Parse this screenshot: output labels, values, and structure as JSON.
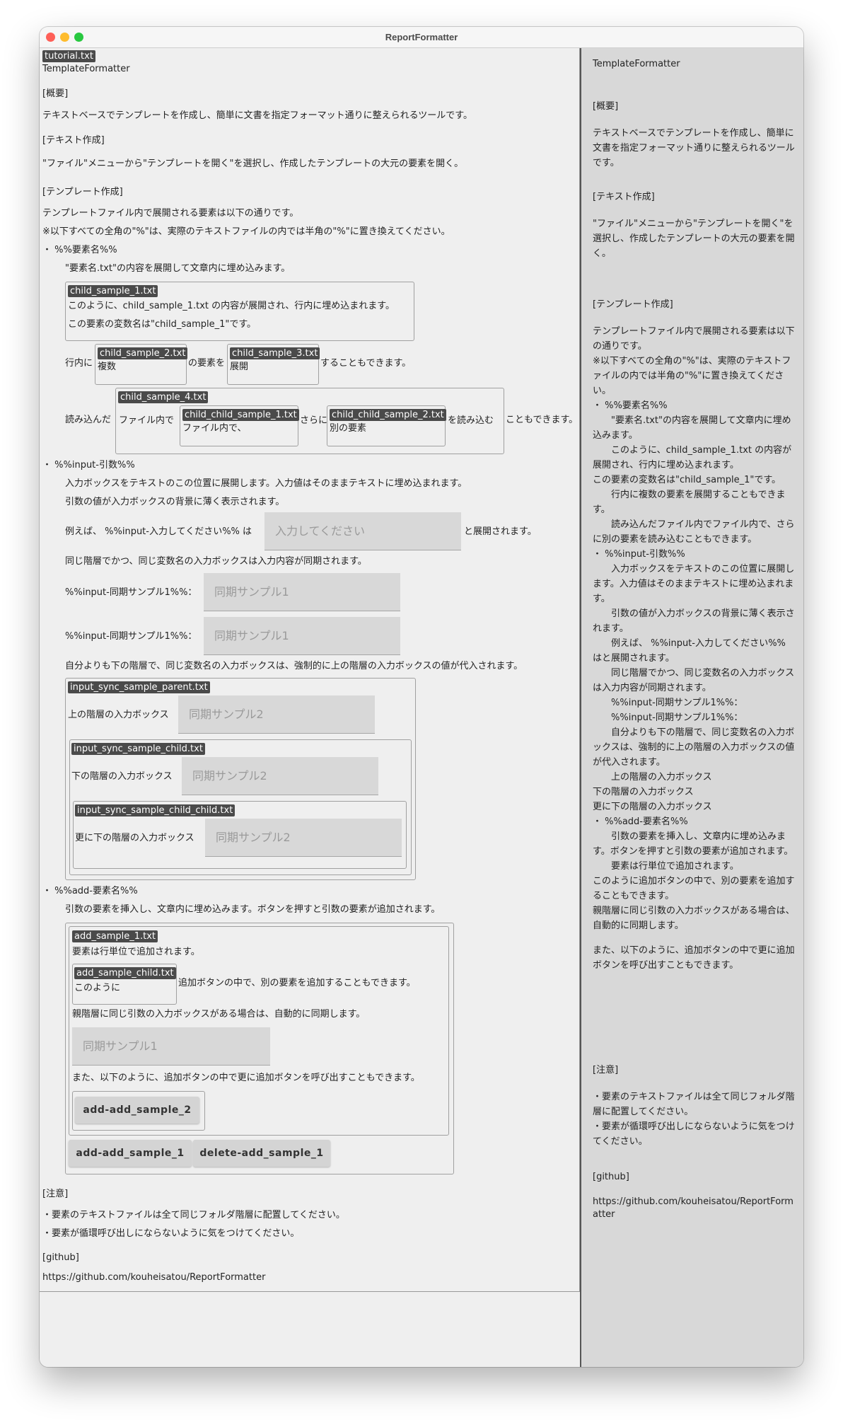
{
  "window": {
    "title": "ReportFormatter"
  },
  "editor": {
    "file_tag": "tutorial.txt",
    "title": "TemplateFormatter",
    "overview_head": "[概要]",
    "overview_text": "テキストベースでテンプレートを作成し、簡単に文書を指定フォーマット通りに整えられるツールです。",
    "text_head": "[テキスト作成]",
    "text_desc": "\"ファイル\"メニューから\"テンプレートを開く\"を選択し、作成したテンプレートの大元の要素を開く。",
    "template_head": "[テンプレート作成]",
    "template_line1": "テンプレートファイル内で展開される要素は以下の通りです。",
    "template_line2": "※以下すべての全角の\"%\"は、実際のテキストファイルの内では半角の\"%\"に置き換えてください。",
    "element_bullet": "・ %%要素名%%",
    "element_desc": "\"要素名.txt\"の内容を展開して文章内に埋め込みます。",
    "child1_tag": "child_sample_1.txt",
    "child1_line1": "このように、child_sample_1.txt の内容が展開され、行内に埋め込まれます。",
    "child1_line2": "この要素の変数名は\"child_sample_1\"です。",
    "inline_pre": "行内に",
    "child2_tag": "child_sample_2.txt",
    "child2_text": "複数",
    "inline_mid": "の要素を",
    "child3_tag": "child_sample_3.txt",
    "child3_text": "展開",
    "inline_post": "することもできます。",
    "nested_pre": "読み込んだ",
    "child4_tag": "child_sample_4.txt",
    "child4_text": "ファイル内で",
    "cc1_tag": "child_child_sample_1.txt",
    "cc1_text": "ファイル内で、",
    "nested_mid": "さらに",
    "cc2_tag": "child_child_sample_2.txt",
    "cc2_text": "別の要素",
    "nested_mid2": "を読み込む",
    "nested_post": "こともできます。",
    "input_bullet": "・ %%input-引数%%",
    "input_desc1": "入力ボックスをテキストのこの位置に展開します。入力値はそのままテキストに埋め込まれます。",
    "input_desc2": "引数の値が入力ボックスの背景に薄く表示されます。",
    "example_pre": "例えば、 %%input-入力してください%% は",
    "example_placeholder": "入力してください",
    "example_post": "と展開されます。",
    "sync_desc": "同じ階層でかつ、同じ変数名の入力ボックスは入力内容が同期されます。",
    "sync_label1": "%%input-同期サンプル1%%：",
    "sync_placeholder1": "同期サンプル1",
    "sync_label2": "%%input-同期サンプル1%%：",
    "sync_placeholder2": "同期サンプル1",
    "lower_desc": "自分よりも下の階層で、同じ変数名の入力ボックスは、強制的に上の階層の入力ボックスの値が代入されます。",
    "parent_tag": "input_sync_sample_parent.txt",
    "parent_label": "上の階層の入力ボックス",
    "parent_placeholder": "同期サンプル2",
    "child_tag": "input_sync_sample_child.txt",
    "child_label": "下の階層の入力ボックス",
    "child_placeholder": "同期サンプル2",
    "cchild_tag": "input_sync_sample_child_child.txt",
    "cchild_label": "更に下の階層の入力ボックス",
    "cchild_placeholder": "同期サンプル2",
    "add_bullet": "・ %%add-要素名%%",
    "add_desc": "引数の要素を挿入し、文章内に埋め込みます。ボタンを押すと引数の要素が追加されます。",
    "add1_tag": "add_sample_1.txt",
    "add1_line": "要素は行単位で追加されます。",
    "addchild_tag": "add_sample_child.txt",
    "addchild_text": "このように",
    "addchild_post": "追加ボタンの中で、別の要素を追加することもできます。",
    "add_sync_desc": "親階層に同じ引数の入力ボックスがある場合は、自動的に同期します。",
    "add_placeholder": "同期サンプル1",
    "add_nested_desc": "また、以下のように、追加ボタンの中で更に追加ボタンを呼び出すこともできます。",
    "addadd2_button": "add-add_sample_2",
    "addadd1_button": "add-add_sample_1",
    "delete_button": "delete-add_sample_1",
    "notes_head": "[注意]",
    "note1": "・要素のテキストファイルは全て同じフォルダ階層に配置してください。",
    "note2": "・要素が循環呼び出しにならないように気をつけてください。",
    "github_head": "[github]",
    "github_url": "https://github.com/kouheisatou/ReportFormatter"
  },
  "preview": {
    "title": "TemplateFormatter",
    "overview_head": "[概要]",
    "overview_text": "テキストベースでテンプレートを作成し、簡単に文書を指定フォーマット通りに整えられるツールです。",
    "text_head": "[テキスト作成]",
    "text_desc": "\"ファイル\"メニューから\"テンプレートを開く\"を選択し、作成したテンプレートの大元の要素を開く。",
    "template_head": "[テンプレート作成]",
    "template_line1": "テンプレートファイル内で展開される要素は以下の通りです。",
    "template_line2": "※以下すべての全角の\"%\"は、実際のテキストファイルの内では半角の\"%\"に置き換えてください。",
    "element_bullet": "・ %%要素名%%",
    "element_desc": "　　\"要素名.txt\"の内容を展開して文章内に埋め込みます。",
    "child1_line": "　　このように、child_sample_1.txt の内容が展開され、行内に埋め込まれます。",
    "child1_line2": "この要素の変数名は\"child_sample_1\"です。",
    "inline_line": "　　行内に複数の要素を展開することもできます。",
    "nested_line": "　　読み込んだファイル内でファイル内で、さらに別の要素を読み込むこともできます。",
    "input_bullet": "・ %%input-引数%%",
    "input_desc1": "　　入力ボックスをテキストのこの位置に展開します。入力値はそのままテキストに埋め込まれます。",
    "input_desc2": "　　引数の値が入力ボックスの背景に薄く表示されます。",
    "example_line": "　　例えば、 %%input-入力してください%% はと展開されます。",
    "sync_desc": "　　同じ階層でかつ、同じ変数名の入力ボックスは入力内容が同期されます。",
    "sync_label1": "　　%%input-同期サンプル1%%：",
    "sync_label2": "　　%%input-同期サンプル1%%：",
    "lower_desc": "　　自分よりも下の階層で、同じ変数名の入力ボックスは、強制的に上の階層の入力ボックスの値が代入されます。",
    "parent_label": "　　上の階層の入力ボックス",
    "child_label": "下の階層の入力ボックス",
    "cchild_label": "更に下の階層の入力ボックス",
    "add_bullet": "・ %%add-要素名%%",
    "add_desc": "　　引数の要素を挿入し、文章内に埋め込みます。ボタンを押すと引数の要素が追加されます。",
    "add1_line": "　　要素は行単位で追加されます。",
    "addchild_line": "このように追加ボタンの中で、別の要素を追加することもできます。",
    "add_sync_desc": "親階層に同じ引数の入力ボックスがある場合は、自動的に同期します。",
    "add_nested_desc": "また、以下のように、追加ボタンの中で更に追加ボタンを呼び出すこともできます。",
    "notes_head": "[注意]",
    "note1": "・要素のテキストファイルは全て同じフォルダ階層に配置してください。",
    "note2": "・要素が循環呼び出しにならないように気をつけてください。",
    "github_head": "[github]",
    "github_url": "https://github.com/kouheisatou/ReportFormatter"
  }
}
